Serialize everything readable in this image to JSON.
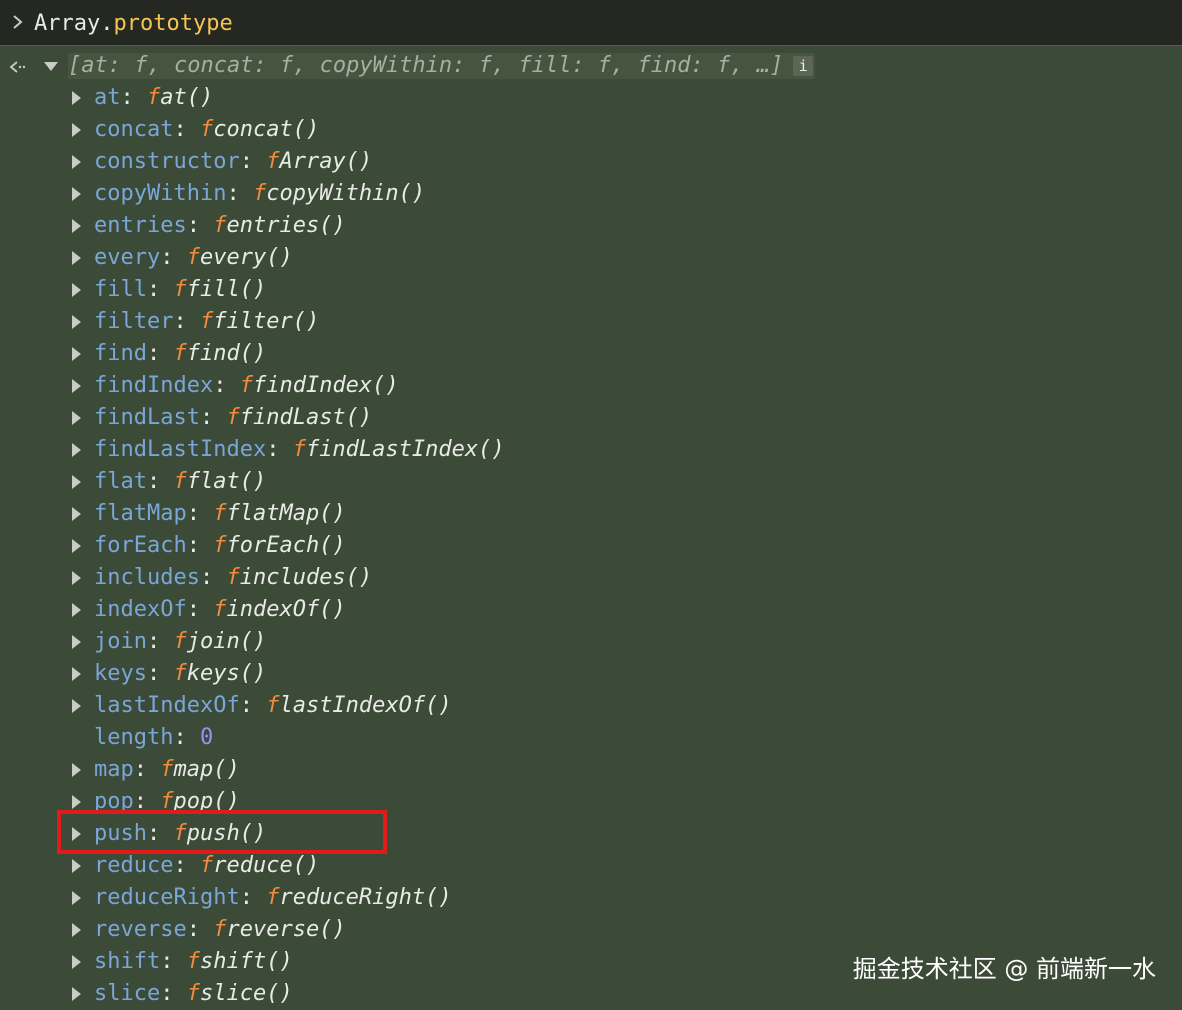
{
  "input": {
    "object": "Array",
    "dot": ".",
    "property": "prototype"
  },
  "summary": {
    "text": "[at: f, concat: f, copyWithin: f, fill: f, find: f, …]",
    "info_badge": "i"
  },
  "properties": [
    {
      "key": "at",
      "fn": "at()"
    },
    {
      "key": "concat",
      "fn": "concat()"
    },
    {
      "key": "constructor",
      "fn": "Array()"
    },
    {
      "key": "copyWithin",
      "fn": "copyWithin()"
    },
    {
      "key": "entries",
      "fn": "entries()"
    },
    {
      "key": "every",
      "fn": "every()"
    },
    {
      "key": "fill",
      "fn": "fill()"
    },
    {
      "key": "filter",
      "fn": "filter()"
    },
    {
      "key": "find",
      "fn": "find()"
    },
    {
      "key": "findIndex",
      "fn": "findIndex()"
    },
    {
      "key": "findLast",
      "fn": "findLast()"
    },
    {
      "key": "findLastIndex",
      "fn": "findLastIndex()"
    },
    {
      "key": "flat",
      "fn": "flat()"
    },
    {
      "key": "flatMap",
      "fn": "flatMap()"
    },
    {
      "key": "forEach",
      "fn": "forEach()"
    },
    {
      "key": "includes",
      "fn": "includes()"
    },
    {
      "key": "indexOf",
      "fn": "indexOf()"
    },
    {
      "key": "join",
      "fn": "join()"
    },
    {
      "key": "keys",
      "fn": "keys()"
    },
    {
      "key": "lastIndexOf",
      "fn": "lastIndexOf()"
    },
    {
      "key": "length",
      "value": "0"
    },
    {
      "key": "map",
      "fn": "map()"
    },
    {
      "key": "pop",
      "fn": "pop()"
    },
    {
      "key": "push",
      "fn": "push()",
      "highlighted": true
    },
    {
      "key": "reduce",
      "fn": "reduce()"
    },
    {
      "key": "reduceRight",
      "fn": "reduceRight()"
    },
    {
      "key": "reverse",
      "fn": "reverse()"
    },
    {
      "key": "shift",
      "fn": "shift()"
    },
    {
      "key": "slice",
      "fn": "slice()"
    }
  ],
  "function_marker": "f",
  "colon": ": ",
  "watermark": "掘金技术社区 @ 前端新一水",
  "colors": {
    "background": "#3c4a38",
    "input_background": "#252723",
    "property_key": "#7aa6d8",
    "function_marker": "#f28b3c",
    "number_value": "#9b8cff",
    "highlight_border": "#e11b1b",
    "input_property": "#f5c453"
  },
  "icons": {
    "prompt": "chevron-right-icon",
    "result": "return-arrow-icon",
    "expanded": "caret-down-icon",
    "collapsed": "caret-right-icon"
  }
}
